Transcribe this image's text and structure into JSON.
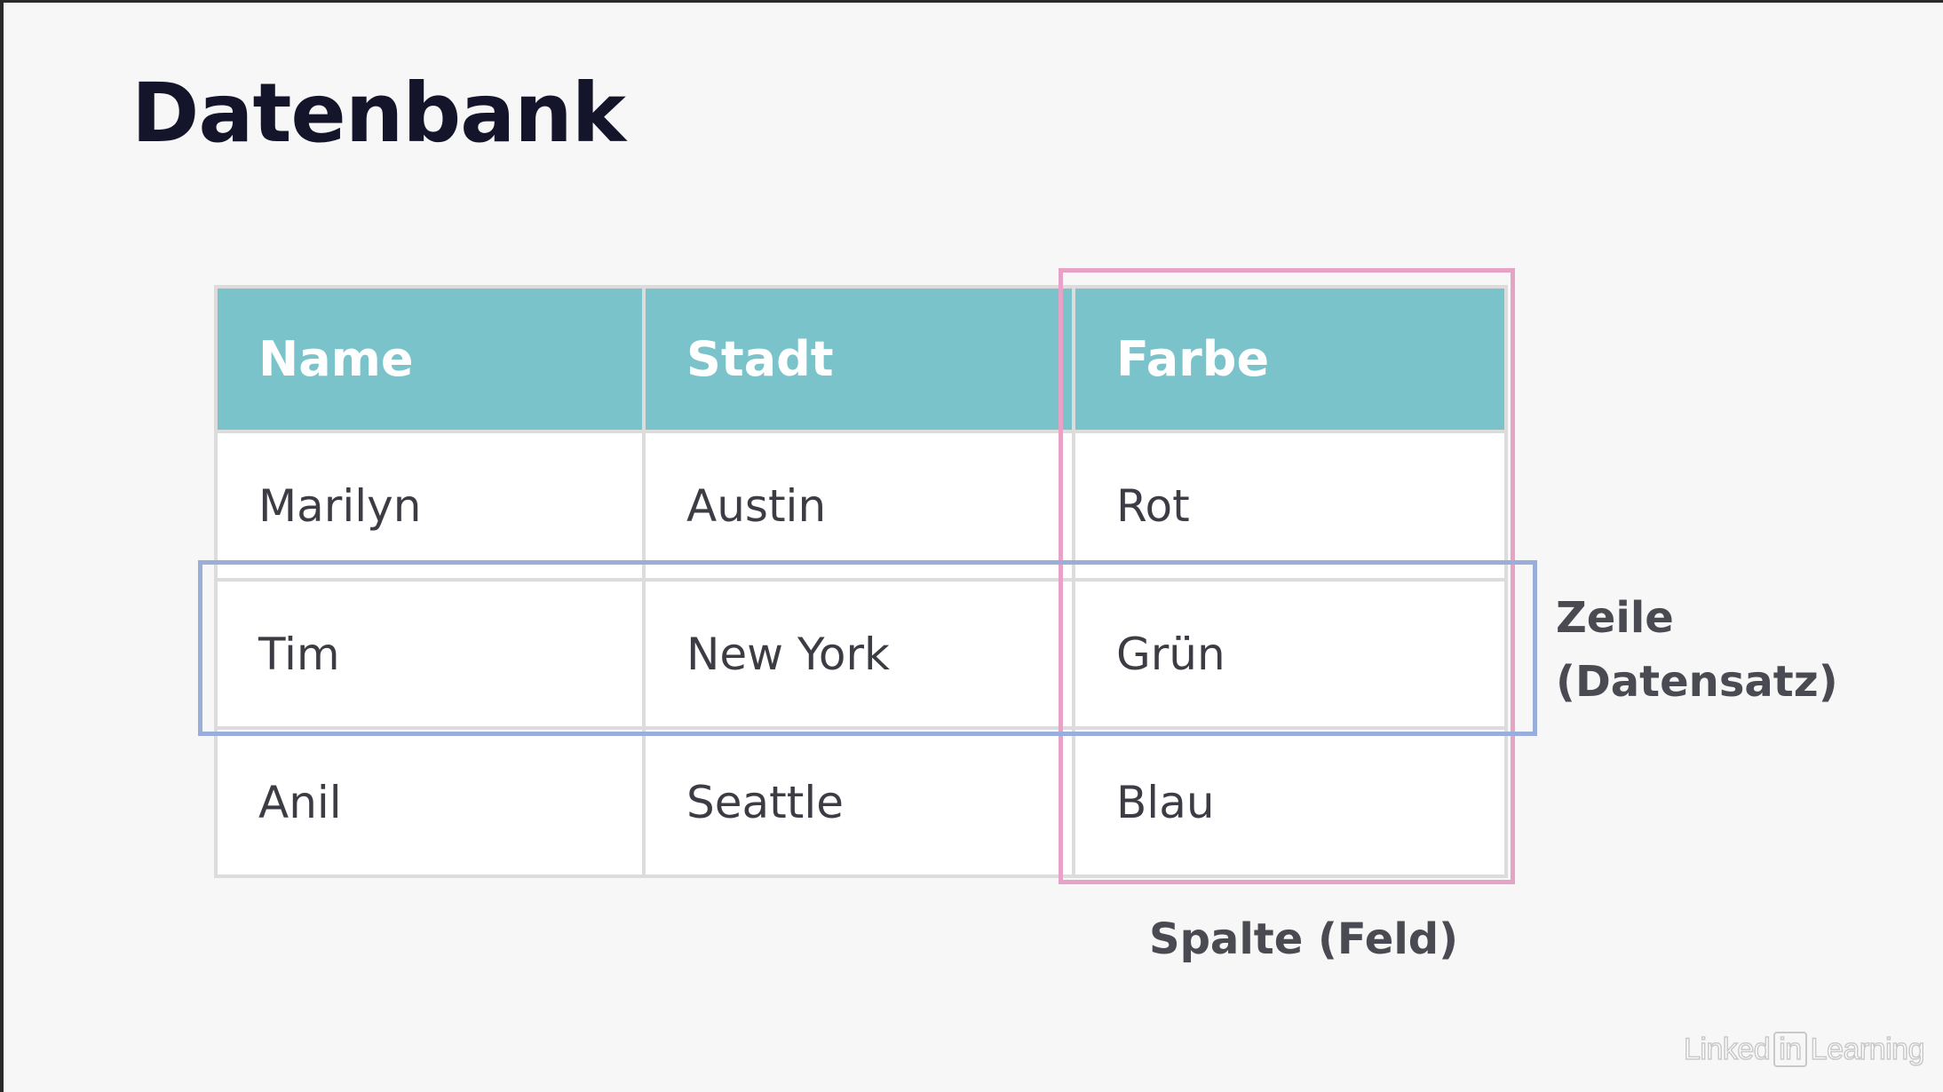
{
  "slide": {
    "title": "Datenbank"
  },
  "table": {
    "headers": [
      "Name",
      "Stadt",
      "Farbe"
    ],
    "rows": [
      [
        "Marilyn",
        "Austin",
        "Rot"
      ],
      [
        "Tim",
        "New York",
        "Grün"
      ],
      [
        "Anil",
        "Seattle",
        "Blau"
      ]
    ]
  },
  "annotations": {
    "row_label_line1": "Zeile",
    "row_label_line2": "(Datensatz)",
    "column_label": "Spalte (Feld)",
    "row_highlight_color": "#9aaedb",
    "column_highlight_color": "#e6a3c6"
  },
  "colors": {
    "header_background": "#7bc3cb",
    "header_text": "#ffffff",
    "title_text": "#14142b"
  },
  "watermark": {
    "part1": "Linked",
    "part2": "in",
    "part3": "Learning"
  }
}
